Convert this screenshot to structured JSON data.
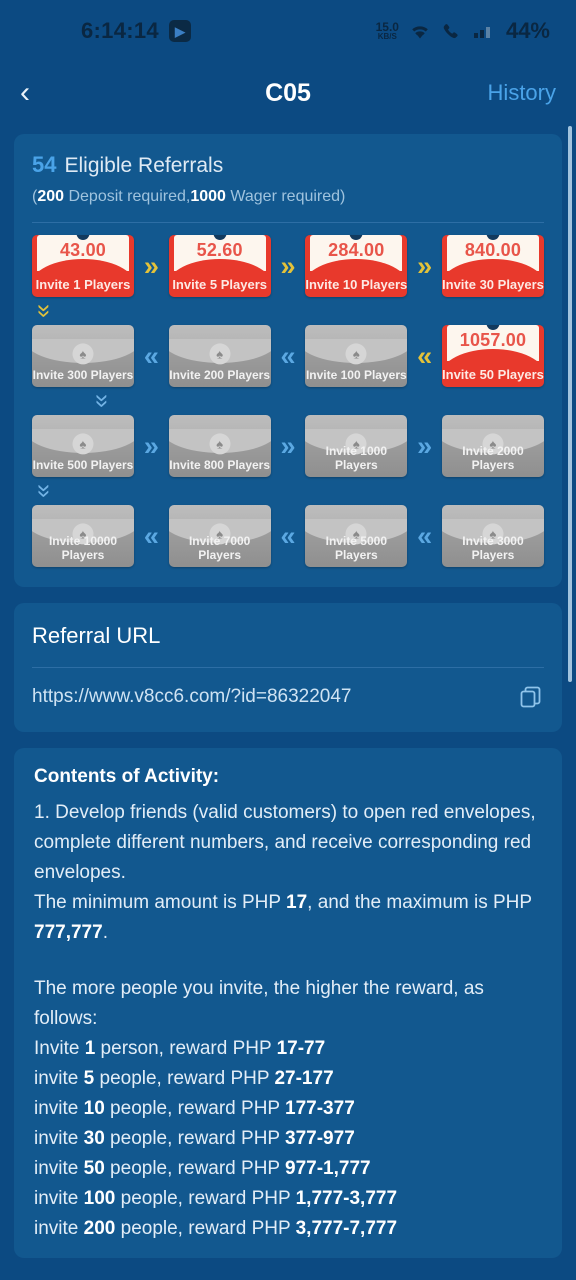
{
  "status_bar": {
    "time": "6:14:14",
    "app_icon": "app-icon",
    "network_speed_value": "15.0",
    "network_speed_unit": "KB/S",
    "wifi_icon": "wifi-icon",
    "call_icon": "call-icon",
    "signal_icon": "signal-icon",
    "battery": "44%"
  },
  "nav": {
    "back_icon": "‹",
    "title": "C05",
    "action_label": "History"
  },
  "referrals": {
    "count": "54",
    "count_label": "Eligible Referrals",
    "requirement_open": "(",
    "deposit_amount": "200",
    "deposit_label": " Deposit required,",
    "wager_amount": "1000",
    "wager_label": " Wager required)",
    "rows": [
      {
        "direction": "right",
        "arrow_style": "gold",
        "arrow_glyph": "»",
        "cards": [
          {
            "state": "active",
            "amount": "43.00",
            "label": "Invite 1 Players"
          },
          {
            "state": "active",
            "amount": "52.60",
            "label": "Invite 5 Players"
          },
          {
            "state": "active",
            "amount": "284.00",
            "label": "Invite 10 Players"
          },
          {
            "state": "active",
            "amount": "840.00",
            "label": "Invite 30 Players"
          }
        ]
      },
      {
        "direction": "left",
        "arrow_style": "gold",
        "arrow_glyph": "«",
        "cards": [
          {
            "state": "locked",
            "amount": "",
            "label": "Invite 300 Players"
          },
          {
            "state": "locked",
            "amount": "",
            "label": "Invite 200 Players"
          },
          {
            "state": "locked",
            "amount": "",
            "label": "Invite 100 Players"
          },
          {
            "state": "active",
            "amount": "1057.00",
            "label": "Invite 50 Players"
          }
        ]
      },
      {
        "direction": "right",
        "arrow_style": "blue",
        "arrow_glyph": "»",
        "cards": [
          {
            "state": "locked",
            "amount": "",
            "label": "Invite 500 Players"
          },
          {
            "state": "locked",
            "amount": "",
            "label": "Invite 800 Players"
          },
          {
            "state": "locked",
            "amount": "",
            "label": "Invite 1000 Players"
          },
          {
            "state": "locked",
            "amount": "",
            "label": "Invite 2000 Players"
          }
        ]
      },
      {
        "direction": "left",
        "arrow_style": "blue",
        "arrow_glyph": "«",
        "cards": [
          {
            "state": "locked",
            "amount": "",
            "label": "Invite 10000 Players"
          },
          {
            "state": "locked",
            "amount": "",
            "label": "Invite 7000 Players"
          },
          {
            "state": "locked",
            "amount": "",
            "label": "Invite 5000 Players"
          },
          {
            "state": "locked",
            "amount": "",
            "label": "Invite 3000 Players"
          }
        ]
      }
    ],
    "connector_1_2": "»",
    "connector_2_3": "»",
    "connector_3_4": "»"
  },
  "referral_url": {
    "title": "Referral URL",
    "url": "https://www.v8cc6.com/?id=86322047",
    "copy_icon": "copy-icon"
  },
  "contents": {
    "title": "Contents of Activity:",
    "para_1": "1. Develop friends (valid customers) to open red envelopes, complete different numbers, and receive corresponding red envelopes.",
    "para_2_pre": "The minimum amount is PHP ",
    "para_2_min": "17",
    "para_2_mid": ", and the maximum is PHP ",
    "para_2_max": "777,777",
    "para_2_end": ".",
    "para_3": "The more people you invite, the higher the reward, as follows:",
    "reward_lines": [
      {
        "pre": "Invite ",
        "count": "1",
        "mid": " person, reward PHP ",
        "amount": "17-77"
      },
      {
        "pre": "invite ",
        "count": "5",
        "mid": " people, reward PHP ",
        "amount": "27-177"
      },
      {
        "pre": "invite ",
        "count": "10",
        "mid": " people, reward PHP ",
        "amount": "177-377"
      },
      {
        "pre": "invite ",
        "count": "30",
        "mid": " people, reward PHP ",
        "amount": "377-977"
      },
      {
        "pre": "invite ",
        "count": "50",
        "mid": " people, reward PHP ",
        "amount": "977-1,777"
      },
      {
        "pre": "invite ",
        "count": "100",
        "mid": " people, reward PHP ",
        "amount": "1,777-3,777"
      },
      {
        "pre": "invite ",
        "count": "200",
        "mid": " people, reward PHP ",
        "amount": "3,777-7,777"
      }
    ]
  },
  "colors": {
    "page_bg": "#0c4a82",
    "panel_bg": "#12588f",
    "accent_blue": "#4aa3e8",
    "envelope_red": "#e8392c",
    "arrow_gold": "#e3c23a",
    "locked_gray": "#a9a9a9"
  }
}
